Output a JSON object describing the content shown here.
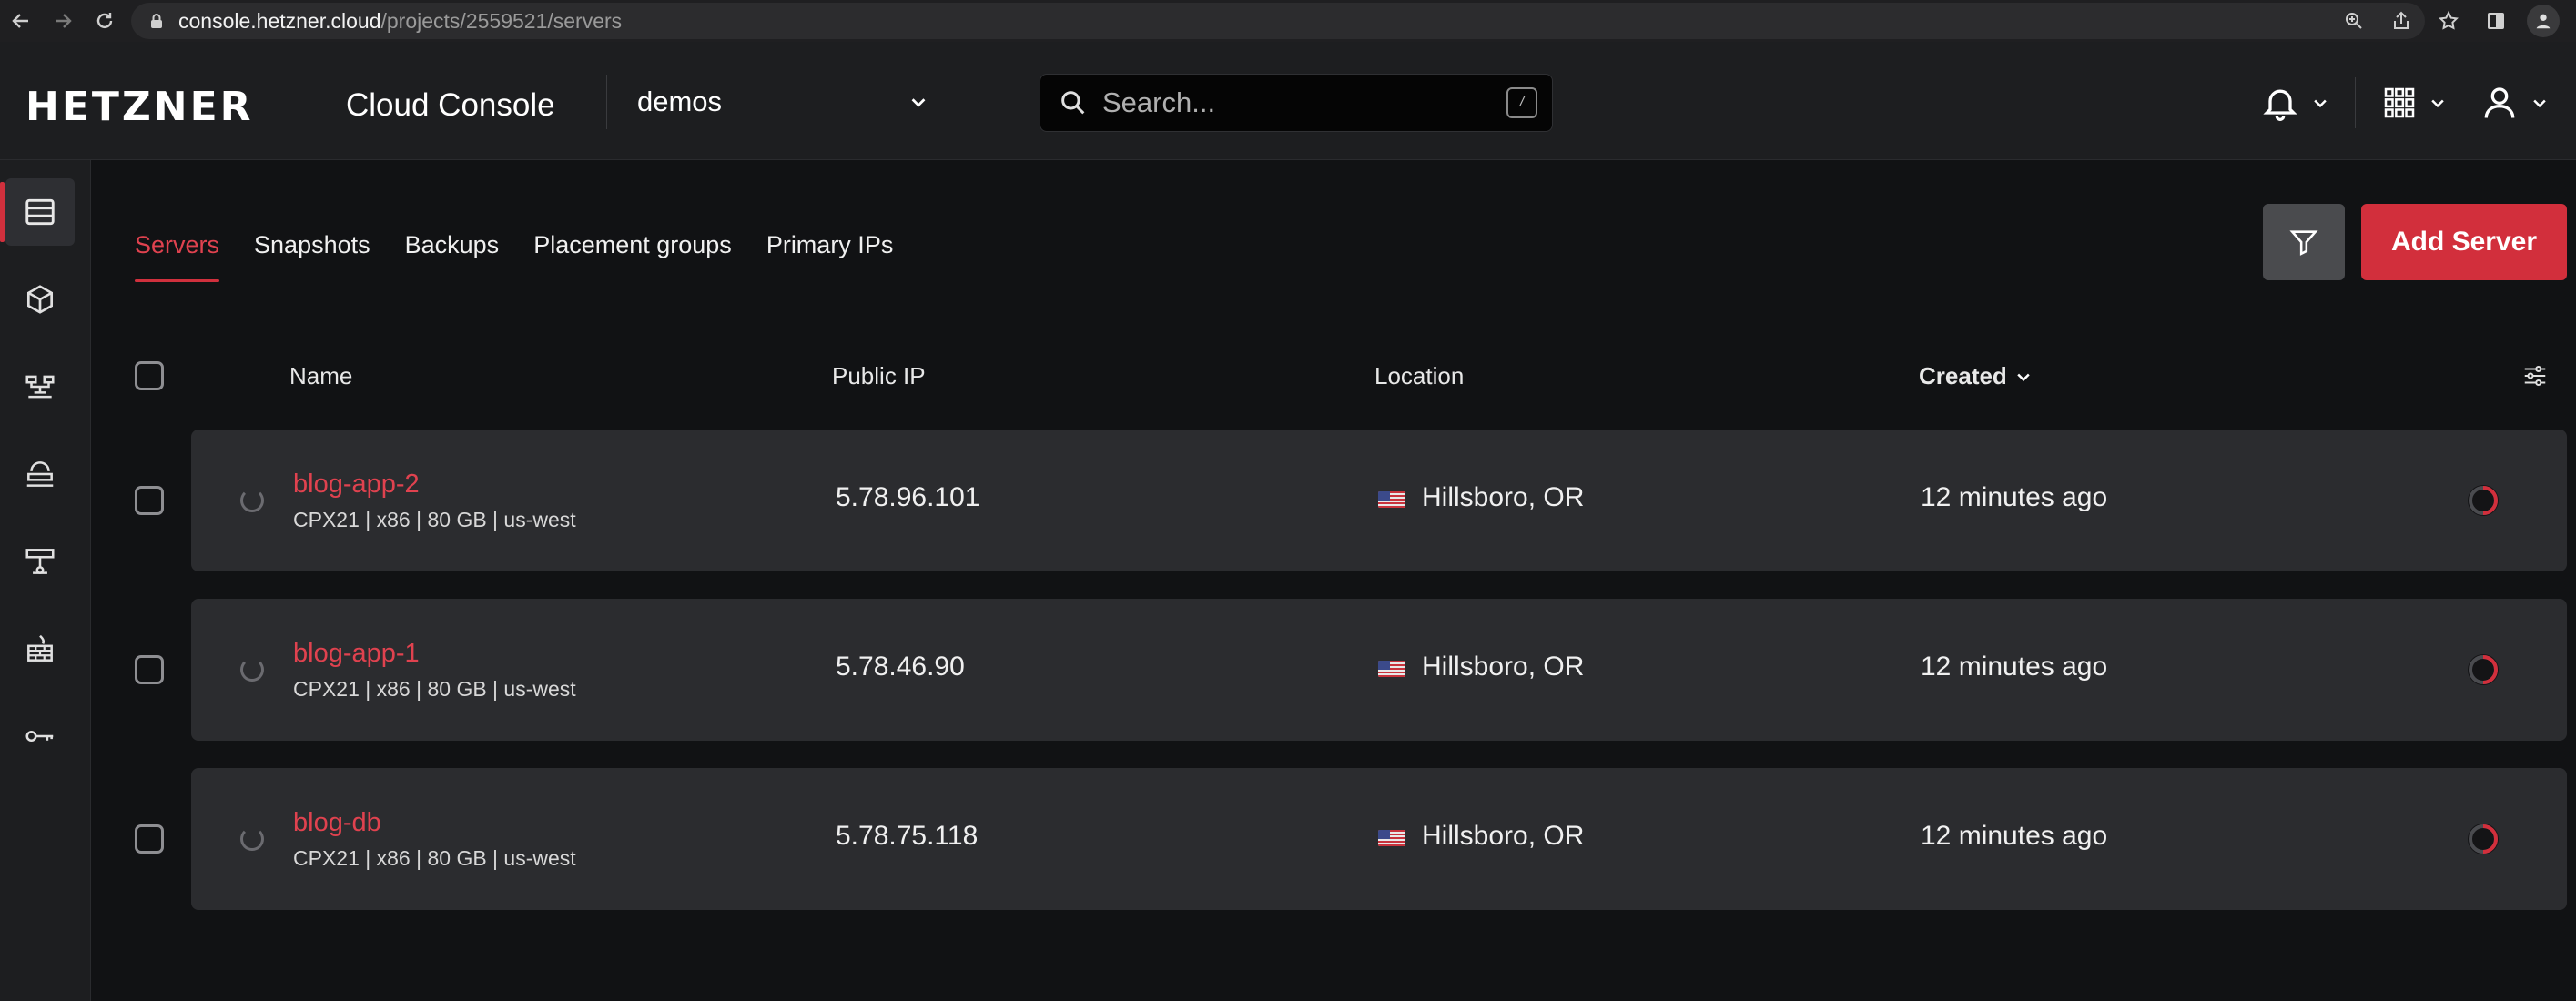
{
  "browser": {
    "url_host": "console.hetzner.cloud",
    "url_path": "/projects/2559521/servers"
  },
  "header": {
    "logo": "HETZNER",
    "product": "Cloud Console",
    "project": "demos",
    "search_placeholder": "Search...",
    "search_shortcut": "/"
  },
  "tabs": [
    {
      "label": "Servers",
      "active": true
    },
    {
      "label": "Snapshots",
      "active": false
    },
    {
      "label": "Backups",
      "active": false
    },
    {
      "label": "Placement groups",
      "active": false
    },
    {
      "label": "Primary IPs",
      "active": false
    }
  ],
  "actions": {
    "add_server": "Add Server"
  },
  "table": {
    "columns": {
      "name": "Name",
      "public_ip": "Public IP",
      "location": "Location",
      "created": "Created"
    },
    "rows": [
      {
        "name": "blog-app-2",
        "meta": "CPX21 | x86 | 80 GB | us-west",
        "ip": "5.78.96.101",
        "location": "Hillsboro, OR",
        "created": "12 minutes ago"
      },
      {
        "name": "blog-app-1",
        "meta": "CPX21 | x86 | 80 GB | us-west",
        "ip": "5.78.46.90",
        "location": "Hillsboro, OR",
        "created": "12 minutes ago"
      },
      {
        "name": "blog-db",
        "meta": "CPX21 | x86 | 80 GB | us-west",
        "ip": "5.78.75.118",
        "location": "Hillsboro, OR",
        "created": "12 minutes ago"
      }
    ]
  },
  "colors": {
    "accent": "#d22f3c",
    "background": "#111214",
    "header": "#1d1e20",
    "row": "#2b2c2f"
  },
  "icons": {
    "sidebar": [
      "servers-icon",
      "volumes-icon",
      "load-balancers-icon",
      "floating-ips-icon",
      "networks-icon",
      "firewalls-icon",
      "security-keys-icon"
    ]
  }
}
